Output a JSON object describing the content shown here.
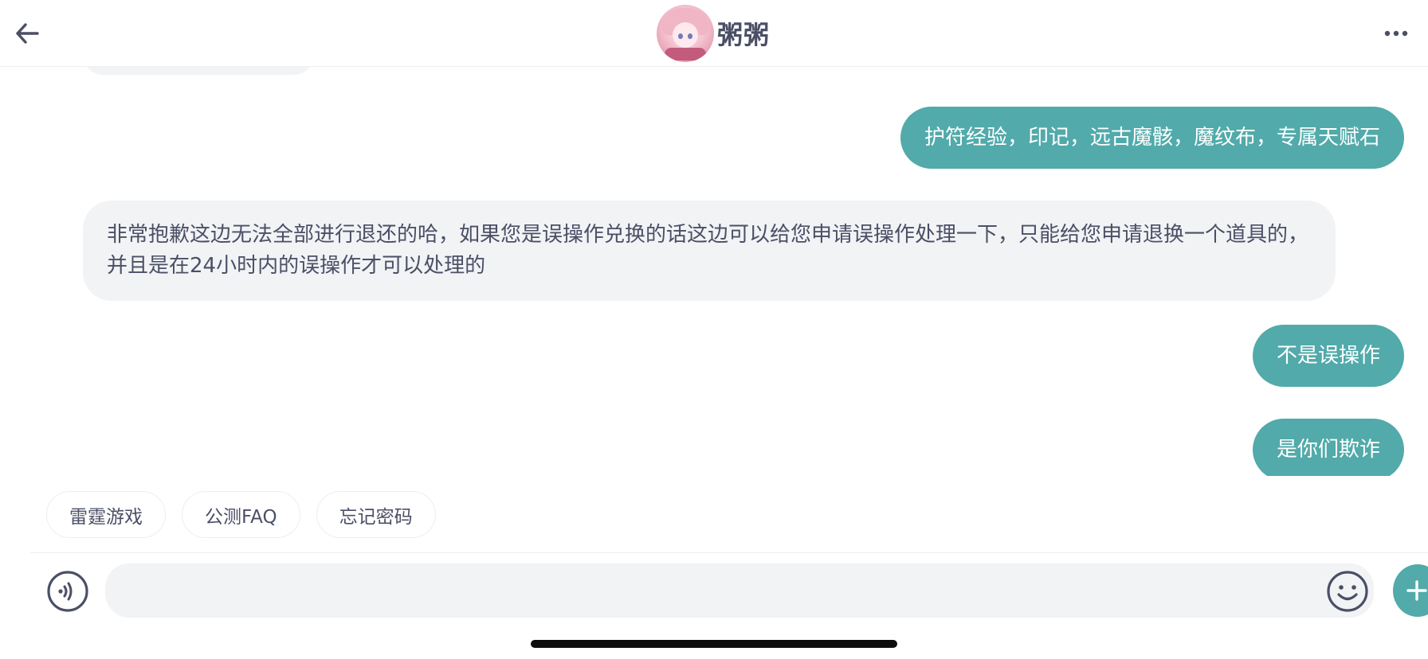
{
  "header": {
    "title": "粥粥",
    "back_icon": "arrow-left-icon",
    "more_icon": "more-horizontal-icon"
  },
  "messages": [
    {
      "from": "user",
      "text": "护符经验，印记，远古魔骸，魔纹布，专属天赋石"
    },
    {
      "from": "agent",
      "text": "非常抱歉这边无法全部进行退还的哈，如果您是误操作兑换的话这边可以给您申请误操作处理一下，只能给您申请退换一个道具的，并且是在24小时内的误操作才可以处理的"
    },
    {
      "from": "user",
      "text": "不是误操作"
    },
    {
      "from": "user",
      "text": "是你们欺诈"
    }
  ],
  "quick_replies": [
    "雷霆游戏",
    "公测FAQ",
    "忘记密码"
  ],
  "input": {
    "value": "",
    "placeholder": ""
  },
  "colors": {
    "accent": "#52aaaa",
    "agent_bubble": "#f2f3f5",
    "text": "#4b4f66"
  }
}
